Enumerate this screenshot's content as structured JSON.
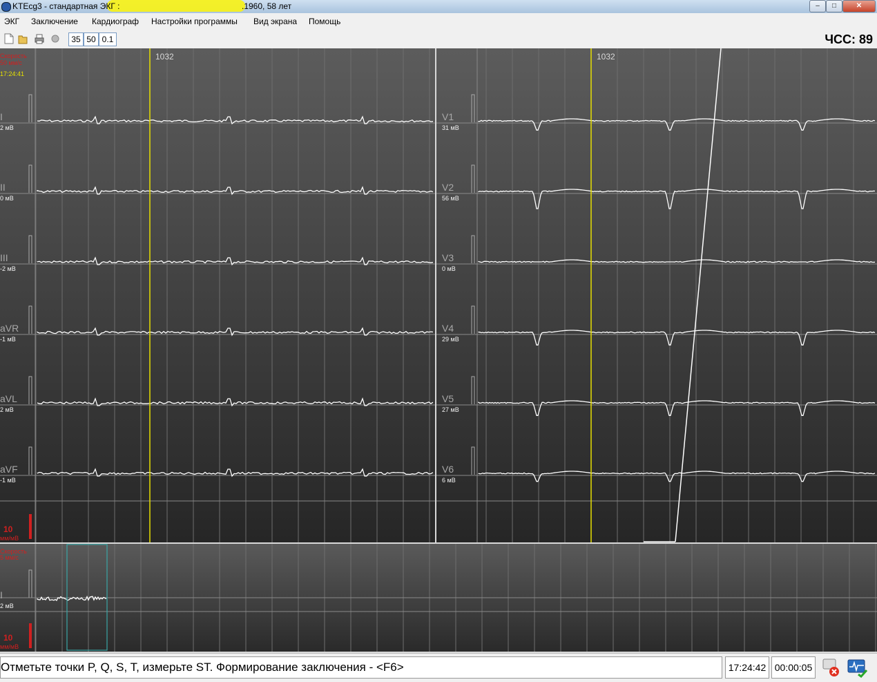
{
  "window": {
    "title_prefix": "KTEcg3 - стандартная ЭКГ :",
    "title_suffix": ".1960, 58 лет",
    "minimize": "–",
    "maximize": "□",
    "close": "✕"
  },
  "menu": {
    "items": [
      "ЭКГ",
      "Заключение",
      "Кардиограф",
      "Настройки программы",
      "Вид экрана",
      "Помощь"
    ]
  },
  "toolbar": {
    "box1": "35",
    "box2": "50",
    "box3": "0.1",
    "icons": [
      "new-file-icon",
      "open-folder-icon",
      "print-icon",
      "record-icon"
    ],
    "heart_rate_label": "ЧСС: 89"
  },
  "top_panel": {
    "speed_label": "Скорость",
    "speed_value": "50 мм/с",
    "time": "17:24:41",
    "amp_value": "10",
    "amp_unit": "мм/мВ",
    "marker_left_label": "1032",
    "marker_right_label": "1032"
  },
  "leads_left": [
    {
      "name": "I",
      "scale": "2 мВ"
    },
    {
      "name": "II",
      "scale": "0 мВ"
    },
    {
      "name": "III",
      "scale": "-2 мВ"
    },
    {
      "name": "aVR",
      "scale": "-1 мВ"
    },
    {
      "name": "aVL",
      "scale": "2 мВ"
    },
    {
      "name": "aVF",
      "scale": "-1 мВ"
    }
  ],
  "leads_right": [
    {
      "name": "V1",
      "scale": "31 мВ"
    },
    {
      "name": "V2",
      "scale": "56 мВ"
    },
    {
      "name": "V3",
      "scale": "0 мВ"
    },
    {
      "name": "V4",
      "scale": "29 мВ"
    },
    {
      "name": "V5",
      "scale": "27 мВ"
    },
    {
      "name": "V6",
      "scale": "6 мВ"
    }
  ],
  "bottom_panel": {
    "speed_label": "Скорость",
    "speed_value": "5 мм/с",
    "lead_name": "I",
    "lead_scale": "2 мВ",
    "amp_value": "10",
    "amp_unit": "мм/мВ"
  },
  "status": {
    "message": "Отметьте точки P, Q, S, T, измерьте ST. Формирование заключения - <F6>",
    "time": "17:24:42",
    "elapsed": "00:00:05",
    "icons": [
      "device-disconnected-icon",
      "monitor-signal-icon"
    ]
  },
  "colors": {
    "trace": "#ffffff",
    "marker": "#e8e000",
    "selection": "#3aa6a6",
    "grid": "#6e6e6e",
    "label_red": "#d02020"
  }
}
